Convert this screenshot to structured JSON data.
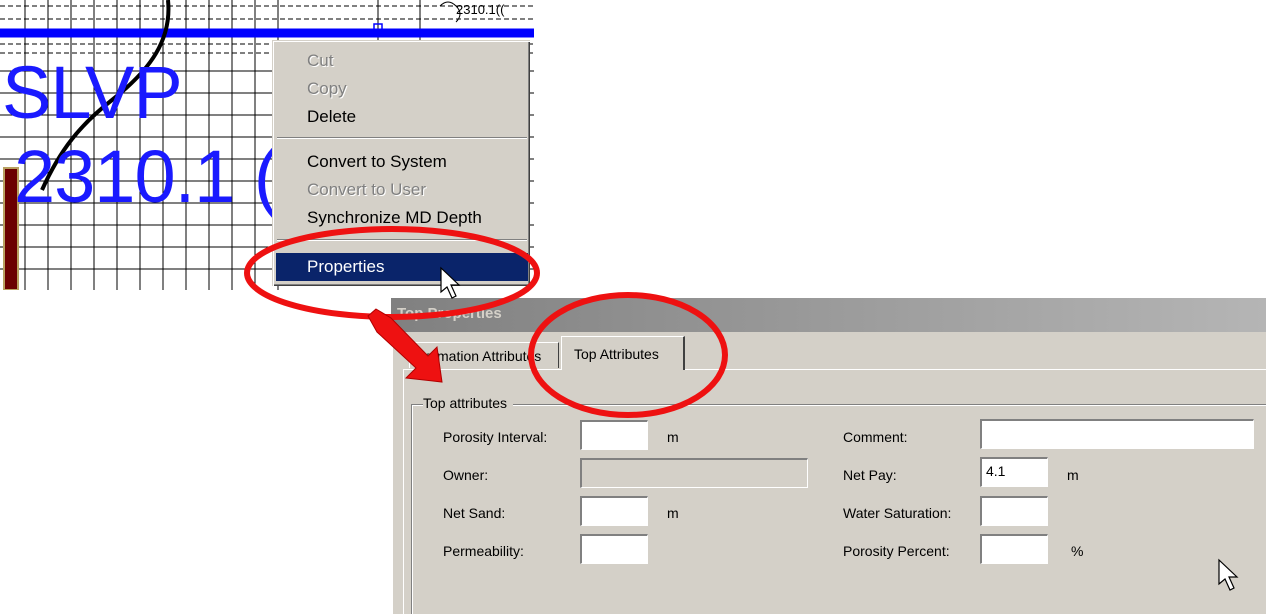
{
  "log_plot": {
    "well_label": "SLVP",
    "depth_label": "2310.1 (",
    "top_marker_text": "2310.1(("
  },
  "context_menu": {
    "items": [
      {
        "label": "Cut",
        "enabled": false
      },
      {
        "label": "Copy",
        "enabled": false
      },
      {
        "label": "Delete",
        "enabled": true
      },
      {
        "label": "Convert to System",
        "enabled": true
      },
      {
        "label": "Convert to User",
        "enabled": false
      },
      {
        "label": "Synchronize MD Depth",
        "enabled": true
      },
      {
        "label": "Properties",
        "enabled": true,
        "selected": true
      }
    ]
  },
  "dialog": {
    "title": "Top Properties",
    "tabs": [
      {
        "label": "Formation Attributes",
        "active": false
      },
      {
        "label": "Top Attributes",
        "active": true
      }
    ],
    "group_title": "Top attributes",
    "fields": {
      "porosity_interval": {
        "label": "Porosity Interval:",
        "value": "",
        "unit": "m"
      },
      "owner": {
        "label": "Owner:",
        "value": ""
      },
      "net_sand": {
        "label": "Net Sand:",
        "value": "",
        "unit": "m"
      },
      "permeability": {
        "label": "Permeability:",
        "value": ""
      },
      "comment": {
        "label": "Comment:",
        "value": ""
      },
      "net_pay": {
        "label": "Net Pay:",
        "value": "4.1",
        "unit": "m"
      },
      "water_saturation": {
        "label": "Water Saturation:",
        "value": ""
      },
      "porosity_percent": {
        "label": "Porosity Percent:",
        "value": "",
        "unit": "%"
      }
    }
  },
  "colors": {
    "highlight_ellipse": "#ee1111",
    "menu_selection": "#0a246a",
    "log_label": "#1a1aff",
    "log_baseline": "#0000ff"
  }
}
